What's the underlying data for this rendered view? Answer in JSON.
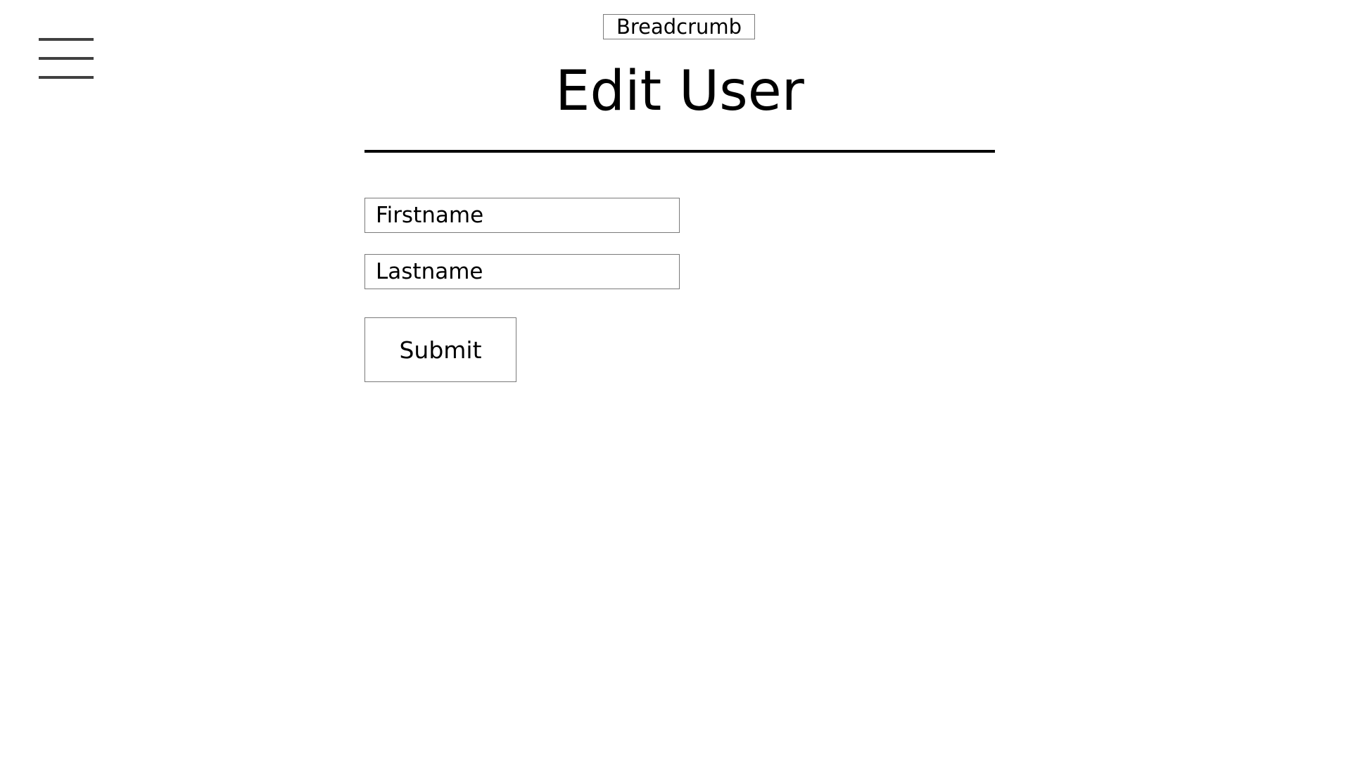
{
  "header": {
    "menu_icon": "hamburger-menu-icon",
    "breadcrumb": "Breadcrumb",
    "title": "Edit User"
  },
  "form": {
    "firstname": {
      "value": "",
      "placeholder": "Firstname"
    },
    "lastname": {
      "value": "",
      "placeholder": "Lastname"
    },
    "submit_label": "Submit"
  },
  "colors": {
    "background": "#ffffff",
    "text": "#000000",
    "border": "#7a7a7a",
    "menu_icon": "#404040",
    "divider": "#000000"
  }
}
